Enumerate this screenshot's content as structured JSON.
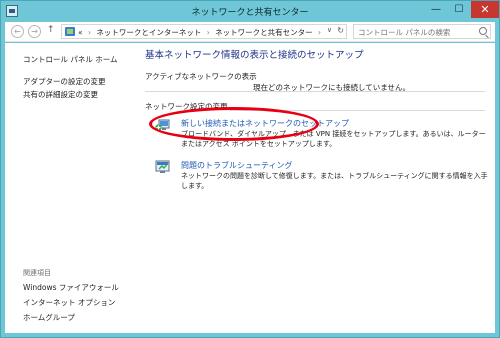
{
  "window": {
    "title": "ネットワークと共有センター",
    "minimize": "—",
    "maximize": "☐",
    "close": "✕"
  },
  "nav": {
    "back": "←",
    "forward": "→",
    "up": "↑",
    "breadcrumb_prefix": "«",
    "breadcrumbs": [
      "ネットワークとインターネット",
      "ネットワークと共有センター"
    ],
    "breadcrumb_sep": "›",
    "dropdown": "∨",
    "refresh": "↻",
    "search_placeholder": "コントロール パネルの検索"
  },
  "sidebar": {
    "home": "コントロール パネル ホーム",
    "links": [
      "アダプターの設定の変更",
      "共有の詳細設定の変更"
    ],
    "related_heading": "関連項目",
    "related_links": [
      "Windows ファイアウォール",
      "インターネット オプション",
      "ホームグループ"
    ]
  },
  "main": {
    "title": "基本ネットワーク情報の表示と接続のセットアップ",
    "active_label": "アクティブなネットワークの表示",
    "active_status": "現在どのネットワークにも接続していません。",
    "change_label": "ネットワーク設定の変更",
    "tasks": [
      {
        "icon": "new-connection-icon",
        "link": "新しい接続またはネットワークのセットアップ",
        "description": "ブロードバンド、ダイヤルアップ、または VPN 接続をセットアップします。あるいは、ルーターまたはアクセス ポイントをセットアップします。"
      },
      {
        "icon": "troubleshoot-icon",
        "link": "問題のトラブルシューティング",
        "description": "ネットワークの問題を診断して修復します。または、トラブルシューティングに関する情報を入手します。"
      }
    ]
  },
  "colors": {
    "title_bar": "#6fc6d6",
    "link": "#1e5ab4",
    "heading": "#1e3287",
    "highlight": "#e60012",
    "close_button": "#c7372f"
  }
}
